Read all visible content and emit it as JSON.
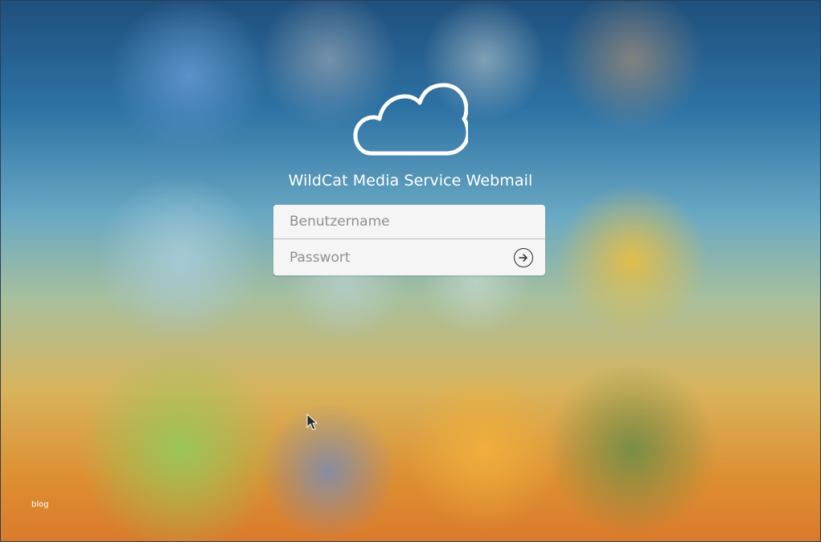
{
  "branding": {
    "logo_icon": "cloud-icon",
    "title": "WildCat Media Service Webmail"
  },
  "login": {
    "username_placeholder": "Benutzername",
    "username_value": "",
    "password_placeholder": "Passwort",
    "password_value": "",
    "submit_icon": "arrow-right-circle-icon"
  },
  "footer": {
    "blog_label": "blog"
  },
  "colors": {
    "accent": "#ffffff",
    "form_bg": "#f5f5f5",
    "divider": "#bdbdbd",
    "placeholder": "#8f8f8f",
    "cursor": "#2a2a2a"
  }
}
